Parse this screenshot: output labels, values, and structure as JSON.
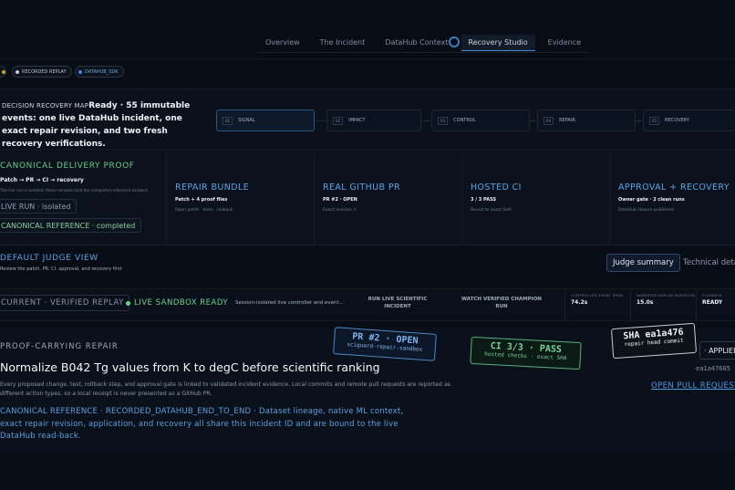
{
  "nav": {
    "tabs": [
      {
        "label": "Overview"
      },
      {
        "label": "The Incident"
      },
      {
        "label": "DataHub Context"
      },
      {
        "label": "Recovery Studio"
      },
      {
        "label": "Evidence"
      }
    ],
    "active_tab": "Recovery Studio"
  },
  "chips": [
    {
      "label": "",
      "color": "#c9a227"
    },
    {
      "label": "RECORDED REPLAY",
      "color": "#c6ced8"
    },
    {
      "label": "DATAHUB_SDK",
      "color": "#3f8bd8"
    }
  ],
  "decision_map": {
    "label": "DECISION RECOVERY MAP",
    "headline": "Ready · 55 immutable events: one live DataHub incident, one exact repair revision, and two fresh recovery verifications.",
    "steps": [
      {
        "num": "01",
        "label": "SIGNAL"
      },
      {
        "num": "02",
        "label": "IMPACT"
      },
      {
        "num": "03",
        "label": "CONTROL"
      },
      {
        "num": "04",
        "label": "REPAIR"
      },
      {
        "num": "05",
        "label": "RECOVERY"
      }
    ]
  },
  "proof": {
    "title": "CANONICAL DELIVERY PROOF",
    "flow": "Patch → PR → CI → recovery",
    "note": "The live run is isolated; these receipts bind the completed reference incident.",
    "live_run": "LIVE RUN · isolated",
    "reference": "CANONICAL REFERENCE · completed",
    "columns": [
      {
        "title": "REPAIR BUNDLE",
        "sub": "Patch + 4 proof files",
        "note": "Open patch · tests · rollback"
      },
      {
        "title": "REAL GITHUB PR",
        "sub": "PR #2 · OPEN",
        "note": "Exact revision ↗"
      },
      {
        "title": "HOSTED CI",
        "sub": "3 / 3 PASS",
        "note": "Bound to exact SHA"
      },
      {
        "title": "APPROVAL + RECOVERY",
        "sub": "Owner gate · 2 clean runs",
        "note": "DataHub closure published"
      }
    ]
  },
  "judge": {
    "title": "DEFAULT JUDGE VIEW",
    "subtitle": "Review the patch, PR, CI, approval, and recovery first",
    "summary_btn": "Judge summary",
    "technical_btn": "Technical details"
  },
  "replay": {
    "current": "CURRENT · VERIFIED REPLAY",
    "live": "LIVE SANDBOX READY",
    "desc": "Session-isolated live controller and event...",
    "action1": "RUN LIVE SCIENTIFIC INCIDENT",
    "action2": "WATCH VERIFIED CHAMPION RUN",
    "metrics": [
      {
        "label": "CONTROLLER EVENT SPAN",
        "value": "74.2s"
      },
      {
        "label": "NARRATED REPLAY DURATION",
        "value": "15.0s"
      },
      {
        "label": "PLAYBACK",
        "value": "READY"
      }
    ]
  },
  "repair": {
    "kicker": "PROOF-CARRYING REPAIR",
    "title": "Normalize B042 Tg values from K to degC before scientific ranking",
    "desc": "Every proposed change, test, rollback step, and approval gate is linked to validated incident evidence. Local commits and remote pull requests are reported as different action types, so a local receipt is never presented as a GitHub PR.",
    "canonical": "CANONICAL REFERENCE · RECORDED_DATAHUB_END_TO_END · Dataset lineage, native ML context, exact repair revision, application, and recovery all share this incident ID and are bound to the live DataHub read-back.",
    "stickers": {
      "pr": {
        "big": "PR #2 · OPEN",
        "small": "sciguard-repair-sandbox"
      },
      "ci": {
        "big": "CI 3/3 · PASS",
        "small": "hosted checks · exact SHA"
      },
      "sha": {
        "big": "SHA ea1a476",
        "small": "repair head commit"
      }
    },
    "apply_label": "· APPLIED",
    "sha_full": "ea1a47605",
    "open_pr": "OPEN PULL REQUEST"
  }
}
